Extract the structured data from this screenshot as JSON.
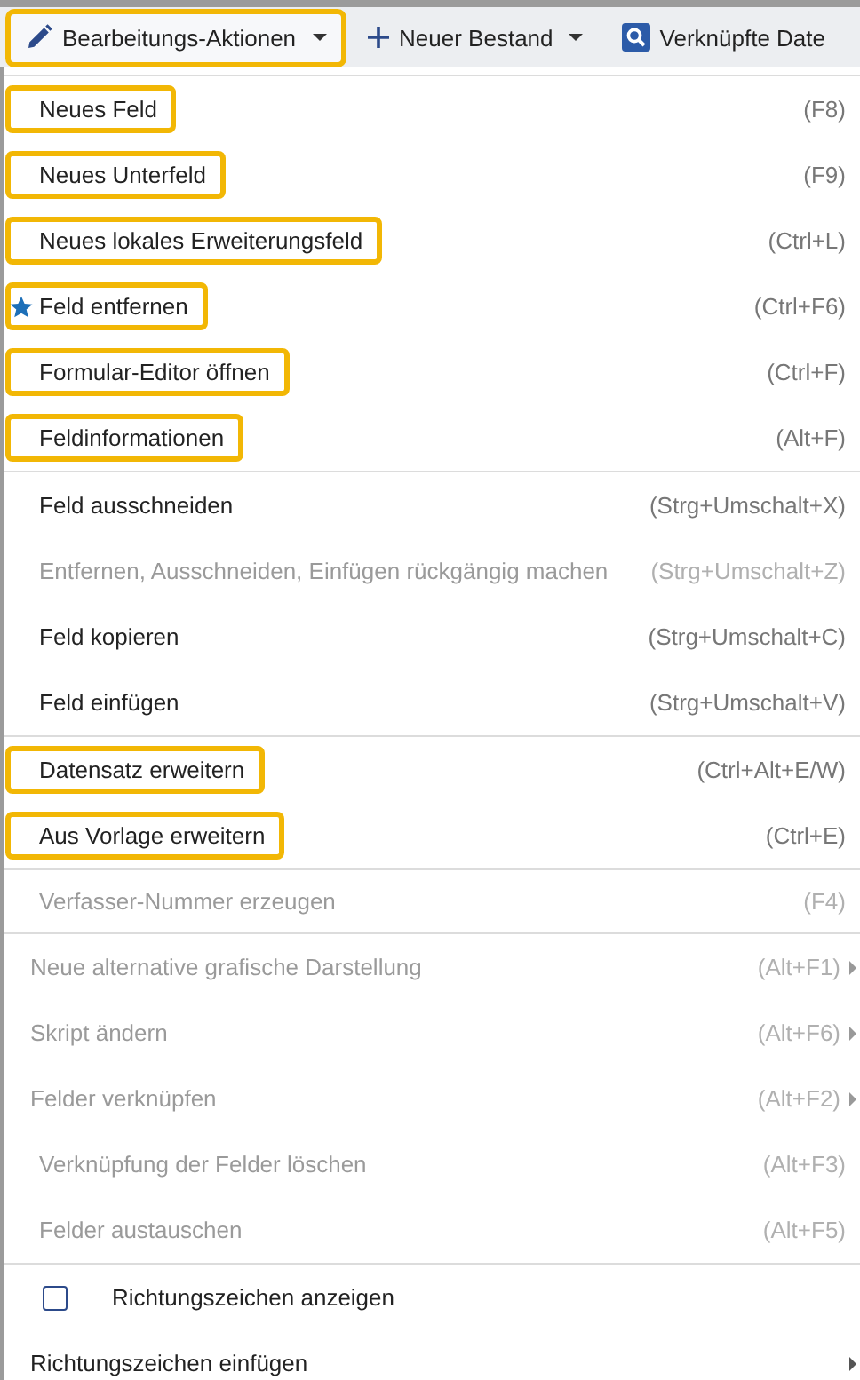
{
  "toolbar": {
    "buttons": [
      {
        "kind": "pencil",
        "label": "Bearbeitungs-Aktionen",
        "dropdown": true,
        "highlighted": true
      },
      {
        "kind": "plus",
        "label": "Neuer Bestand",
        "dropdown": true,
        "highlighted": false
      },
      {
        "kind": "search",
        "label": "Verknüpfte Date",
        "highlighted": false
      }
    ]
  },
  "menu": {
    "sections": [
      {
        "items": [
          {
            "kind": "action",
            "label": "Neues Feld",
            "shortcut": "(F8)",
            "disabled": false,
            "highlighted": true,
            "starred": false
          },
          {
            "kind": "action",
            "label": "Neues Unterfeld",
            "shortcut": "(F9)",
            "disabled": false,
            "highlighted": true,
            "starred": false
          },
          {
            "kind": "action",
            "label": "Neues lokales Erweiterungsfeld",
            "shortcut": "(Ctrl+L)",
            "disabled": false,
            "highlighted": true,
            "starred": false
          },
          {
            "kind": "action",
            "label": "Feld entfernen",
            "shortcut": "(Ctrl+F6)",
            "disabled": false,
            "highlighted": true,
            "starred": true
          },
          {
            "kind": "action",
            "label": "Formular-Editor öffnen",
            "shortcut": "(Ctrl+F)",
            "disabled": false,
            "highlighted": true,
            "starred": false
          },
          {
            "kind": "action",
            "label": "Feldinformationen",
            "shortcut": "(Alt+F)",
            "disabled": false,
            "highlighted": true,
            "starred": false
          }
        ]
      },
      {
        "items": [
          {
            "kind": "action",
            "label": "Feld ausschneiden",
            "shortcut": "(Strg+Umschalt+X)",
            "disabled": false,
            "highlighted": false,
            "starred": false
          },
          {
            "kind": "action",
            "label": "Entfernen, Ausschneiden, Einfügen rückgängig machen",
            "shortcut": "(Strg+Umschalt+Z)",
            "disabled": true,
            "highlighted": false,
            "starred": false
          },
          {
            "kind": "action",
            "label": "Feld kopieren",
            "shortcut": "(Strg+Umschalt+C)",
            "disabled": false,
            "highlighted": false,
            "starred": false
          },
          {
            "kind": "action",
            "label": "Feld einfügen",
            "shortcut": "(Strg+Umschalt+V)",
            "disabled": false,
            "highlighted": false,
            "starred": false
          }
        ]
      },
      {
        "items": [
          {
            "kind": "action",
            "label": "Datensatz erweitern",
            "shortcut": "(Ctrl+Alt+E/W)",
            "disabled": false,
            "highlighted": true,
            "starred": false
          },
          {
            "kind": "action",
            "label": "Aus Vorlage erweitern",
            "shortcut": "(Ctrl+E)",
            "disabled": false,
            "highlighted": true,
            "starred": false
          }
        ]
      },
      {
        "items": [
          {
            "kind": "action",
            "label": "Verfasser-Nummer erzeugen",
            "shortcut": "(F4)",
            "disabled": true,
            "highlighted": false,
            "starred": false
          }
        ]
      },
      {
        "items": [
          {
            "kind": "submenu",
            "label": "Neue alternative grafische Darstellung",
            "shortcut": "(Alt+F1)",
            "disabled": true
          },
          {
            "kind": "submenu",
            "label": "Skript ändern",
            "shortcut": "(Alt+F6)",
            "disabled": true
          },
          {
            "kind": "submenu",
            "label": "Felder verknüpfen",
            "shortcut": "(Alt+F2)",
            "disabled": true
          },
          {
            "kind": "action",
            "label": "Verknüpfung der Felder löschen",
            "shortcut": "(Alt+F3)",
            "disabled": true,
            "highlighted": false,
            "starred": false
          },
          {
            "kind": "action",
            "label": "Felder austauschen",
            "shortcut": "(Alt+F5)",
            "disabled": true,
            "highlighted": false,
            "starred": false
          }
        ]
      },
      {
        "items": [
          {
            "kind": "checkbox",
            "label": "Richtungszeichen anzeigen",
            "checked": false,
            "disabled": false
          },
          {
            "kind": "submenu",
            "label": "Richtungszeichen einfügen",
            "disabled": false
          }
        ]
      }
    ]
  }
}
